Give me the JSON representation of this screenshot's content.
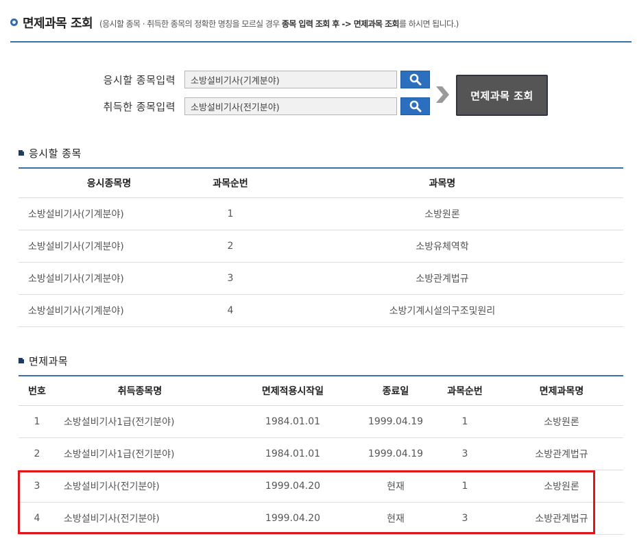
{
  "header": {
    "title": "면제과목 조회",
    "desc_open": "(응시할 종목 · 취득한 종목의 정확한 명칭을 모르실 경우 ",
    "desc_bold1": "종목 입력 조회 후 -> 면제과목 조회",
    "desc_close": "를 하시면 됩니다.)"
  },
  "search": {
    "apply_label": "응시할 종목입력",
    "apply_value": "소방설비기사(기계분야)",
    "owned_label": "취득한 종목입력",
    "owned_value": "소방설비기사(전기분야)",
    "lookup_button": "면제과목 조회"
  },
  "apply_section": {
    "title": "응시할 종목",
    "columns": [
      "응시종목명",
      "과목순번",
      "과목명"
    ],
    "rows": [
      [
        "소방설비기사(기계분야)",
        "1",
        "소방원론"
      ],
      [
        "소방설비기사(기계분야)",
        "2",
        "소방유체역학"
      ],
      [
        "소방설비기사(기계분야)",
        "3",
        "소방관계법규"
      ],
      [
        "소방설비기사(기계분야)",
        "4",
        "소방기계시설의구조및원리"
      ]
    ]
  },
  "exempt_section": {
    "title": "면제과목",
    "columns": [
      "번호",
      "취득종목명",
      "면제적용시작일",
      "종료일",
      "과목순번",
      "면제과목명"
    ],
    "rows": [
      [
        "1",
        "소방설비기사1급(전기분야)",
        "1984.01.01",
        "1999.04.19",
        "1",
        "소방원론"
      ],
      [
        "2",
        "소방설비기사1급(전기분야)",
        "1984.01.01",
        "1999.04.19",
        "3",
        "소방관계법규"
      ],
      [
        "3",
        "소방설비기사(전기분야)",
        "1999.04.20",
        "현재",
        "1",
        "소방원론"
      ],
      [
        "4",
        "소방설비기사(전기분야)",
        "1999.04.20",
        "현재",
        "3",
        "소방관계법규"
      ]
    ]
  },
  "colors": {
    "accent": "#2c6fbf",
    "header_line": "#3a6fa5",
    "highlight": "#e0161b",
    "lookup_button_bg": "#555555"
  },
  "icons": [
    "header-bullet-icon",
    "search-icon",
    "chevron-right-icon",
    "section-bullet-icon"
  ]
}
